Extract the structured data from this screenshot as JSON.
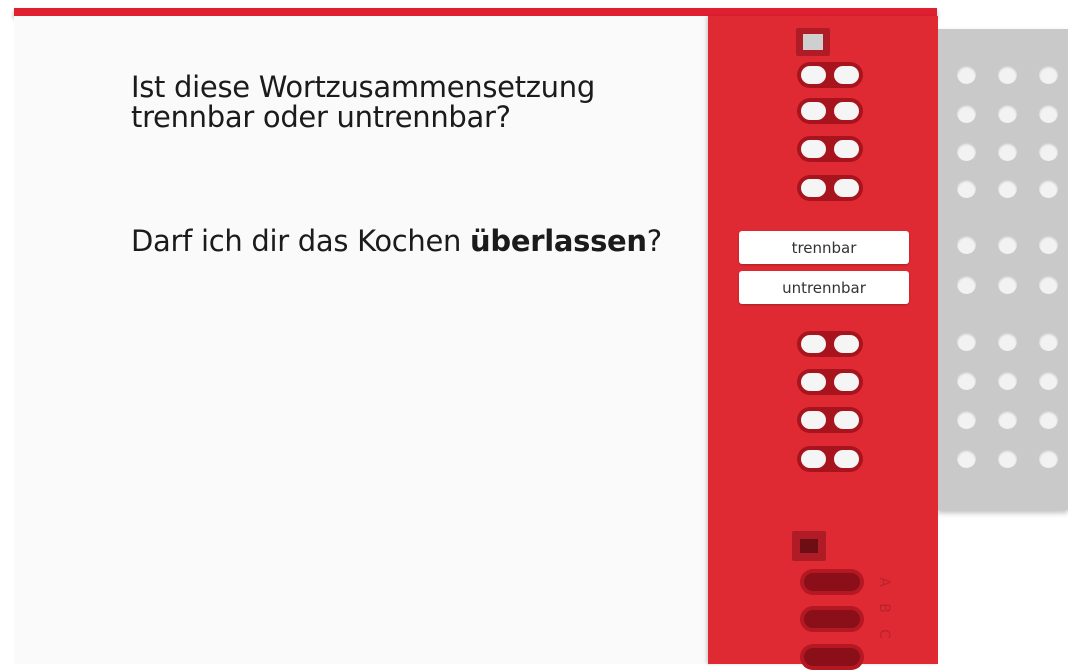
{
  "question": {
    "prompt": "Ist diese Wortzusammensetzung trennbar oder untrennbar?",
    "sentence_before": "Darf ich dir das Kochen ",
    "sentence_highlight": "überlassen",
    "sentence_after": "?"
  },
  "answers": [
    {
      "label": "trennbar"
    },
    {
      "label": "untrennbar"
    }
  ],
  "strip_letters": [
    "A",
    "B",
    "C"
  ],
  "colors": {
    "accent": "#e02a33",
    "board": "#c9c9c9",
    "background": "#fafafa"
  }
}
